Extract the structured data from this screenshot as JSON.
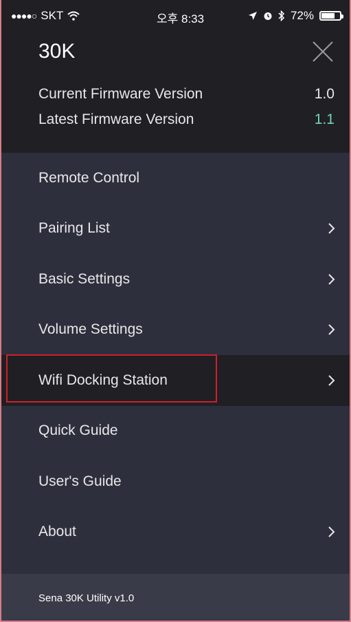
{
  "status_bar": {
    "carrier": "SKT",
    "time": "오후 8:33",
    "battery_percent": "72%",
    "battery_level": 0.72
  },
  "header": {
    "device_name": "30K",
    "current_firmware_label": "Current Firmware Version",
    "current_firmware_value": "1.0",
    "latest_firmware_label": "Latest Firmware Version",
    "latest_firmware_value": "1.1"
  },
  "menu": {
    "items": [
      {
        "label": "Remote Control"
      },
      {
        "label": "Pairing List"
      },
      {
        "label": "Basic Settings"
      },
      {
        "label": "Volume Settings"
      },
      {
        "label": "Wifi Docking Station"
      },
      {
        "label": "Quick Guide"
      },
      {
        "label": "User's Guide"
      },
      {
        "label": "About"
      }
    ]
  },
  "footer": {
    "text": "Sena 30K Utility v1.0"
  },
  "colors": {
    "header_bg": "#1f1f24",
    "menu_bg": "#2e2f3c",
    "footer_bg": "#3a3b48",
    "accent_green": "#74d6b3",
    "highlight_red": "#d11f2a"
  }
}
